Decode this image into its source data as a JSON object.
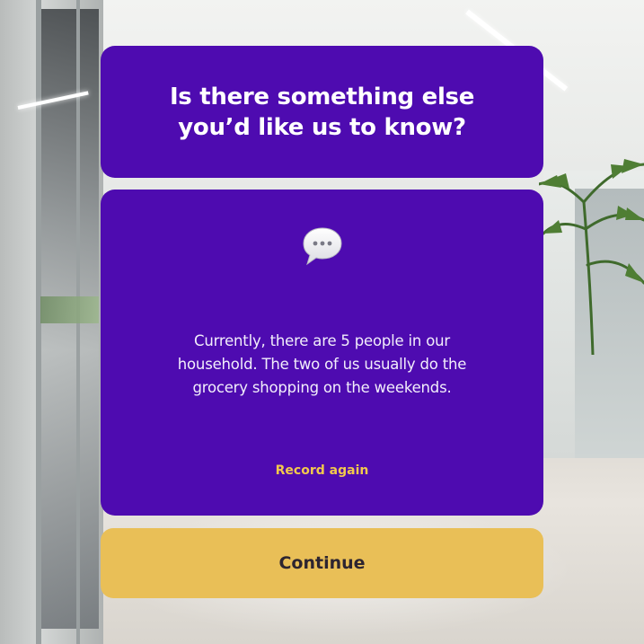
{
  "prompt": {
    "title": "Is there something else you’d like us to know?"
  },
  "answer": {
    "icon": "speech-bubble-icon",
    "transcript": "Currently, there are 5 people in our household. The two of us usually do the grocery shopping on the weekends.",
    "record_again_label": "Record again"
  },
  "actions": {
    "continue_label": "Continue"
  },
  "colors": {
    "card": "#4e0bb0",
    "accent": "#e9bf57",
    "link": "#f2c94c"
  }
}
